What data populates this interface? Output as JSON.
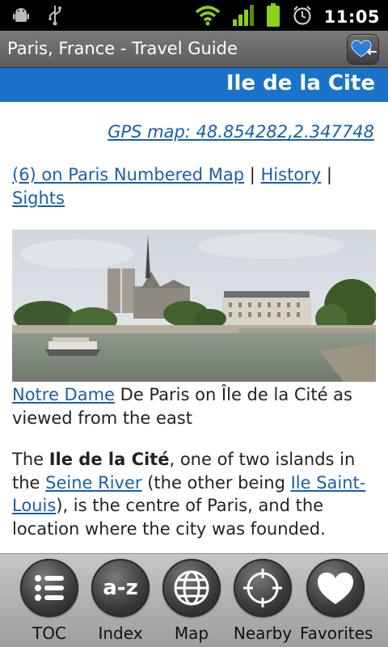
{
  "status_bar": {
    "time": "11:05",
    "icons": [
      "android-debug-icon",
      "usb-icon",
      "wifi-icon",
      "signal-icon",
      "battery-icon",
      "alarm-icon"
    ]
  },
  "app": {
    "title": "Paris, France - Travel Guide"
  },
  "page": {
    "title": "Ile de la Cite",
    "gps_link": "GPS map: 48.854282,2.347748",
    "links": {
      "numbered_map": "(6) on Paris Numbered Map",
      "sep1": " | ",
      "history": "History",
      "sep2": " |",
      "sights": "Sights"
    },
    "caption": {
      "link": "Notre Dame",
      "text": " De Paris on Île de la Cité as viewed from the east"
    },
    "paragraph": {
      "t1": "The ",
      "bold": "Ile de la Cité",
      "t2": ", one of two islands in the ",
      "link1": "Seine River",
      "t3": " (the other being ",
      "link2": "Ile Saint-Louis",
      "t4": "), is the centre of Paris, and the location where the city was founded."
    }
  },
  "toolbar": {
    "items": [
      {
        "label": "TOC",
        "icon": "list-icon"
      },
      {
        "label": "Index",
        "icon": "a-z-icon"
      },
      {
        "label": "Map",
        "icon": "globe-icon"
      },
      {
        "label": "Nearby",
        "icon": "crosshair-icon"
      },
      {
        "label": "Favorites",
        "icon": "heart-icon"
      }
    ],
    "index_glyph": "a-z"
  },
  "colors": {
    "header_blue": "#1a73c8",
    "link": "#1a5fa8",
    "status_green": "#8ad11c"
  }
}
